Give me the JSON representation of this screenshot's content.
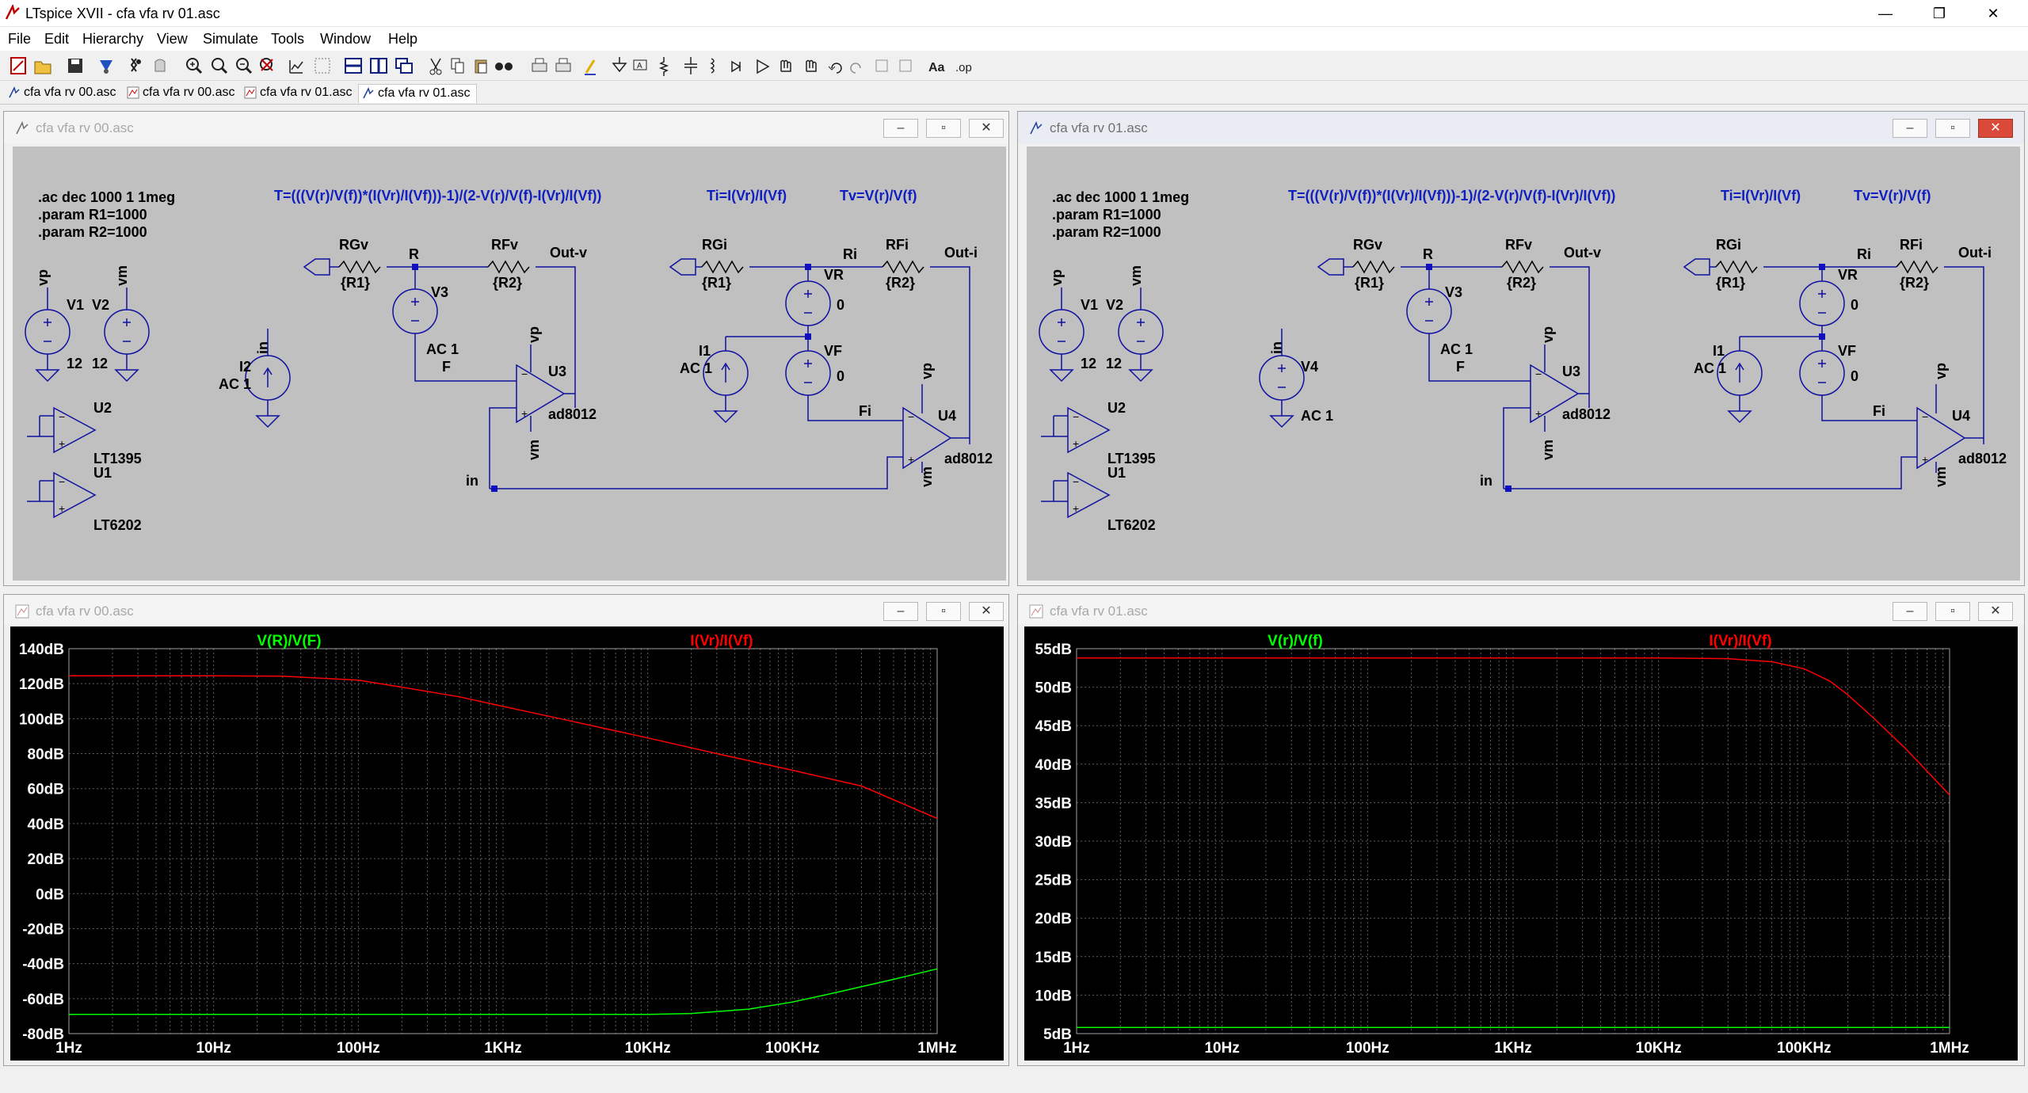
{
  "app": {
    "title": "LTspice XVII - cfa vfa rv 01.asc",
    "controls": {
      "minimize": "—",
      "restore": "❐",
      "close": "✕"
    }
  },
  "menu": [
    "File",
    "Edit",
    "Hierarchy",
    "View",
    "Simulate",
    "Tools",
    "Window",
    "Help"
  ],
  "toolbar_icons": [
    "new-schematic-icon",
    "open-icon",
    "save-icon",
    "control-panel-icon",
    "run-icon",
    "halt-icon",
    "zoom-in-icon",
    "pan-icon",
    "zoom-out-icon",
    "zoom-cancel-icon",
    "autorange-icon",
    "zoom-fit-icon",
    "tile-horizontal-icon",
    "tile-vertical-icon",
    "cascade-icon",
    "cut-icon",
    "copy-icon",
    "paste-icon",
    "find-icon",
    "print-setup-icon",
    "print-icon",
    "draw-wire-icon",
    "ground-icon",
    "label-net-icon",
    "resistor-icon",
    "capacitor-icon",
    "inductor-icon",
    "diode-icon",
    "component-icon",
    "move-icon",
    "drag-icon",
    "undo-icon",
    "redo-icon",
    "rotate-icon",
    "mirror-icon",
    "text-icon",
    "spice-directive-icon"
  ],
  "tabs": [
    {
      "label": "cfa vfa rv 00.asc",
      "icon": "schematic-icon",
      "active": false
    },
    {
      "label": "cfa vfa rv 00.asc",
      "icon": "waveform-icon",
      "active": false
    },
    {
      "label": "cfa vfa rv 01.asc",
      "icon": "waveform-icon",
      "active": false
    },
    {
      "label": "cfa vfa rv 01.asc",
      "icon": "schematic-icon",
      "active": true
    }
  ],
  "schematic": {
    "directives": [
      ".ac dec 1000 1 1meg",
      ".param R1=1000",
      ".param R2=1000"
    ],
    "formula_T": "T=(((V(r)/V(f))*(I(Vr)/I(Vf)))-1)/(2-V(r)/V(f)-I(Vr)/I(Vf))",
    "formula_Ti": "Ti=I(Vr)/I(Vf)",
    "formula_Tv": "Tv=V(r)/V(f)",
    "labels": {
      "vp": "vp",
      "vm": "vm",
      "v1": "V1",
      "v2": "V2",
      "v12": "12",
      "u2": "U2",
      "u1": "U1",
      "lt1395": "LT1395",
      "lt6202": "LT6202",
      "rgv": "RGv",
      "rfv": "RFv",
      "r1": "{R1}",
      "r2": "{R2}",
      "r": "R",
      "v3": "V3",
      "ac1": "AC 1",
      "f": "F",
      "out_v": "Out-v",
      "u3": "U3",
      "ad8012": "ad8012",
      "in": "in",
      "i2": "I2",
      "v4": "V4",
      "rgi": "RGi",
      "rfi": "RFi",
      "ri": "Ri",
      "out_i": "Out-i",
      "vr": "VR",
      "zero": "0",
      "i1": "I1",
      "vf": "VF",
      "fi": "Fi",
      "u4": "U4"
    }
  },
  "windows": {
    "sch0_title": "cfa vfa rv 00.asc",
    "sch1_title": "cfa vfa rv 01.asc",
    "plot0_title": "cfa vfa rv 00.asc",
    "plot1_title": "cfa vfa rv 01.asc"
  },
  "chart_data": [
    {
      "type": "line",
      "x_scale": "log",
      "xlim": [
        1,
        1000000
      ],
      "x_ticks": [
        "1Hz",
        "10Hz",
        "100Hz",
        "1KHz",
        "10KHz",
        "100KHz",
        "1MHz"
      ],
      "ylim": [
        -80,
        140
      ],
      "y_ticks": [
        "140dB",
        "120dB",
        "100dB",
        "80dB",
        "60dB",
        "40dB",
        "20dB",
        "0dB",
        "-20dB",
        "-40dB",
        "-60dB",
        "-80dB"
      ],
      "grid": true,
      "series": [
        {
          "name": "V(R)/V(F)",
          "color": "#00ff00",
          "x": [
            1,
            10,
            100,
            1000,
            10000,
            20000,
            50000,
            100000,
            200000,
            500000,
            1000000
          ],
          "y": [
            -69,
            -69,
            -69,
            -69,
            -69,
            -68.5,
            -66,
            -62,
            -56.5,
            -49,
            -43
          ]
        },
        {
          "name": "I(Vr)/I(Vf)",
          "color": "#ff0000",
          "x": [
            1,
            10,
            30,
            100,
            200,
            500,
            1000,
            3000,
            10000,
            30000,
            100000,
            300000,
            1000000
          ],
          "y": [
            124.5,
            124.5,
            124.3,
            122,
            118,
            112.5,
            107,
            98.5,
            89,
            80,
            70.5,
            61.5,
            43
          ]
        }
      ]
    },
    {
      "type": "line",
      "x_scale": "log",
      "xlim": [
        1,
        1000000
      ],
      "x_ticks": [
        "1Hz",
        "10Hz",
        "100Hz",
        "1KHz",
        "10KHz",
        "100KHz",
        "1MHz"
      ],
      "ylim": [
        5,
        55
      ],
      "y_ticks": [
        "55dB",
        "50dB",
        "45dB",
        "40dB",
        "35dB",
        "30dB",
        "25dB",
        "20dB",
        "15dB",
        "10dB",
        "5dB"
      ],
      "grid": true,
      "series": [
        {
          "name": "V(r)/V(f)",
          "color": "#00ff00",
          "x": [
            1,
            1000000
          ],
          "y": [
            5.8,
            5.8
          ]
        },
        {
          "name": "I(Vr)/I(Vf)",
          "color": "#ff0000",
          "x": [
            1,
            1000,
            10000,
            30000,
            60000,
            100000,
            150000,
            200000,
            300000,
            500000,
            1000000
          ],
          "y": [
            53.8,
            53.8,
            53.8,
            53.7,
            53.3,
            52.4,
            50.8,
            49,
            46,
            42,
            36
          ]
        }
      ]
    }
  ]
}
